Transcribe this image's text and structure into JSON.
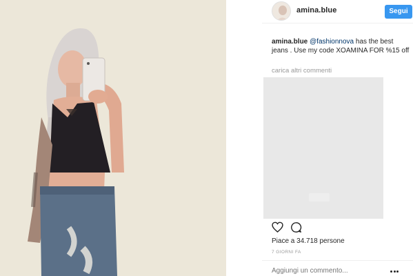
{
  "post": {
    "image_alt": "Mirror selfie photo",
    "colors": {
      "photo_wall": "#e9e4d6",
      "follow_button": "#3897f0",
      "mention": "#003569"
    }
  },
  "header": {
    "username": "amina.blue",
    "follow_label": "Segui"
  },
  "caption": {
    "username": "amina.blue",
    "mention": "@fashionnova",
    "text": " has the best jeans . Use my code XOAMINA FOR %15 off"
  },
  "comments": {
    "load_more_label": "carica altri commenti"
  },
  "actions": {
    "like_icon": "heart-icon",
    "comment_icon": "comment-bubble-icon"
  },
  "likes": {
    "text": "Piace a 34.718 persone"
  },
  "date": {
    "text": "7 GIORNI FA"
  },
  "comment_input": {
    "placeholder": "Aggiungi un commento..."
  }
}
